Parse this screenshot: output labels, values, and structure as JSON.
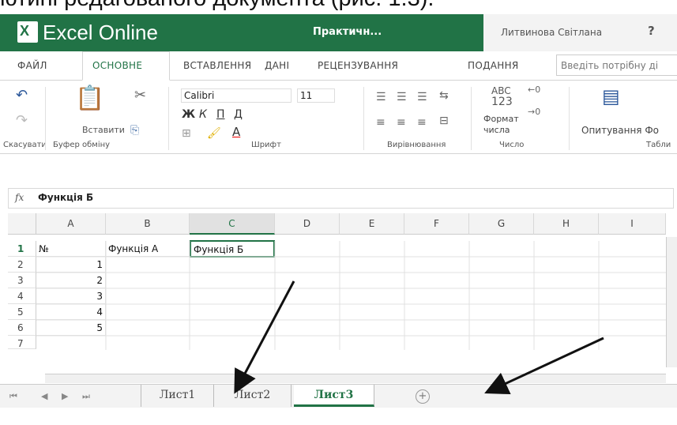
{
  "caption": "ютині редагованого документа (рис. 1.3).",
  "app": {
    "logo_letter": "X",
    "name": "Excel Online",
    "doc_title": "Практичн...",
    "user": "Литвинова Світлана",
    "help": "?"
  },
  "tabs": [
    "ФАЙЛ",
    "ОСНОВНЕ",
    "ВСТАВЛЕННЯ",
    "ДАНІ",
    "РЕЦЕНЗУВАННЯ",
    "ПОДАННЯ"
  ],
  "search_placeholder": "Введіть потрібну ді",
  "ribbon": {
    "undo_label": "Скасувати",
    "clipboard_label": "Буфер обміну",
    "paste_label": "Вставити",
    "font_name": "Calibri",
    "font_size": "11",
    "font_group_label": "Шрифт",
    "align_group_label": "Вирівнювання",
    "number_format_label1": "Формат",
    "number_format_label2": "числа",
    "number_group_label": "Число",
    "abc": "ABC",
    "n123": "123",
    "survey_label": "Опитування Фо",
    "tables_label": "Табли"
  },
  "formula": {
    "fx": "fx",
    "value": "Функція Б"
  },
  "columns": [
    "A",
    "B",
    "C",
    "D",
    "E",
    "F",
    "G",
    "H",
    "I"
  ],
  "rows": [
    "1",
    "2",
    "3",
    "4",
    "5",
    "6",
    "7"
  ],
  "cells": {
    "a1": "№",
    "b1": "Функція А",
    "c1": "Функція Б",
    "a2": "1",
    "a3": "2",
    "a4": "3",
    "a5": "4",
    "a6": "5"
  },
  "sheets": [
    "Лист1",
    "Лист2",
    "Лист3"
  ],
  "active_sheet": "Лист3",
  "accent_color": "#217346"
}
